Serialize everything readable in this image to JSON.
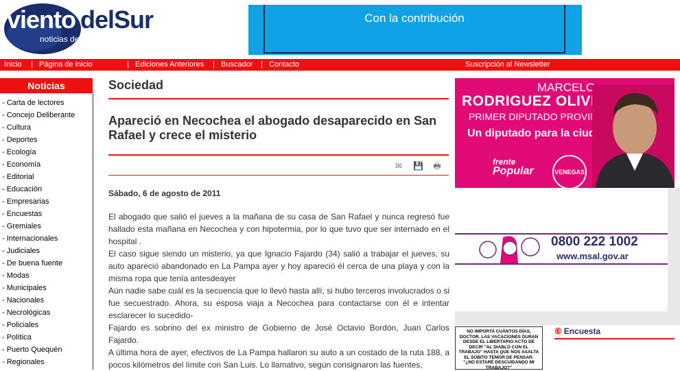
{
  "logo": {
    "name_part1": "viento",
    "name_part2": "delSur",
    "tagline": "noticias de Necochea y Quequén"
  },
  "top_banner": {
    "text": "Con la contribución"
  },
  "nav": {
    "inicio": "Inicio",
    "pagina_inicio": "Página de inicio",
    "ediciones": "Ediciones Anteriores",
    "buscador": "Buscador",
    "contacto": "Contacto",
    "newsletter": "Suscripción al Newsletter"
  },
  "sidebar": {
    "title": "Noticias",
    "items": [
      "- Carta de lectores",
      "- Concejo Deliberante",
      "- Cultura",
      "- Deportes",
      "- Ecología",
      "- Economía",
      "- Editorial",
      "- Educación",
      "- Empresarias",
      "- Encuestas",
      "- Gremiales",
      "- Internacionales",
      "- Judiciales",
      "- De buena fuente",
      "- Modas",
      "- Municipales",
      "- Nacionales",
      "- Necrológicas",
      "- Policiales",
      "- Política",
      "- Puerto Quequén",
      "- Regionales"
    ]
  },
  "article": {
    "section": "Sociedad",
    "headline": "Apareció en Necochea el abogado desaparecido en San Rafael y crece el misterio",
    "date": "Sábado, 6 de agosto de 2011",
    "paragraphs": [
      "El abogado que salió el jueves a la mañana de su casa de San Rafael y nunca regresó fue hallado esta mañana en  Necochea y con hipotermia, por lo que tuvo que ser internado en el hospital .",
      "El caso sigue siendo un misterio, ya que Ignacio Fajardo (34) salió a trabajar el jueves, su auto apareció abandonado en La Pampa ayer y hoy apareció él  cerca de una playa y con la misma ropa que tenía antesdeayer",
      "Aún nadie sabe cuál es la secuencia que lo llevó hasta allí, si hubo terceros involucrados o si fue secuestrado. Ahora, su esposa viaja a Necochea para contactarse con él e intentar esclarecer lo sucedido-",
      "Fajardo es sobrino del ex ministro de Gobierno de José Octavio Bordón, Juan Carlos Fajardo.",
      "A última hora de ayer, efectivos de La Pampa hallaron su auto a un costado de la ruta 188, a pocos kilómetros del límite con San Luis. Lo llamativo, según consignaron las fuentes,"
    ],
    "tools": {
      "email": "✉",
      "save": "💾",
      "print": "🖶"
    }
  },
  "ad_candidate": {
    "name1": "MARCELO",
    "name2": "RODRIGUEZ OLIVERA",
    "role": "PRIMER DIPUTADO PROVINCIAL",
    "slogan": "Un diputado para la ciudad.",
    "party_line1": "frente",
    "party_line2": "Popular",
    "badge": "VENEGAS"
  },
  "ad_health": {
    "phone": "0800 222 1002",
    "site": "www.msal.gov.ar"
  },
  "comic": {
    "text": "NO IMPORTA CUÁNTOS DÍAS, DOCTOR. LAS VACACIONES DURAN DESDE EL LIBERTARIO ACTO DE DECIR \"AL DIABLO CON EL TRABAJO\" HASTA QUE NOS ASALTA EL SÚBITO TEMOR DE PENSAR: \"¿NO ESTARÉ DESCUIDANDO MI TRABAJO?\""
  },
  "survey": {
    "title": "Encuesta",
    "icon": "circle-number-icon"
  },
  "colors": {
    "brand_red": "#ee1111",
    "logo_blue": "#1a2d6b",
    "banner_blue": "#0fa3e6",
    "candidate_pink": "#e10a77"
  }
}
